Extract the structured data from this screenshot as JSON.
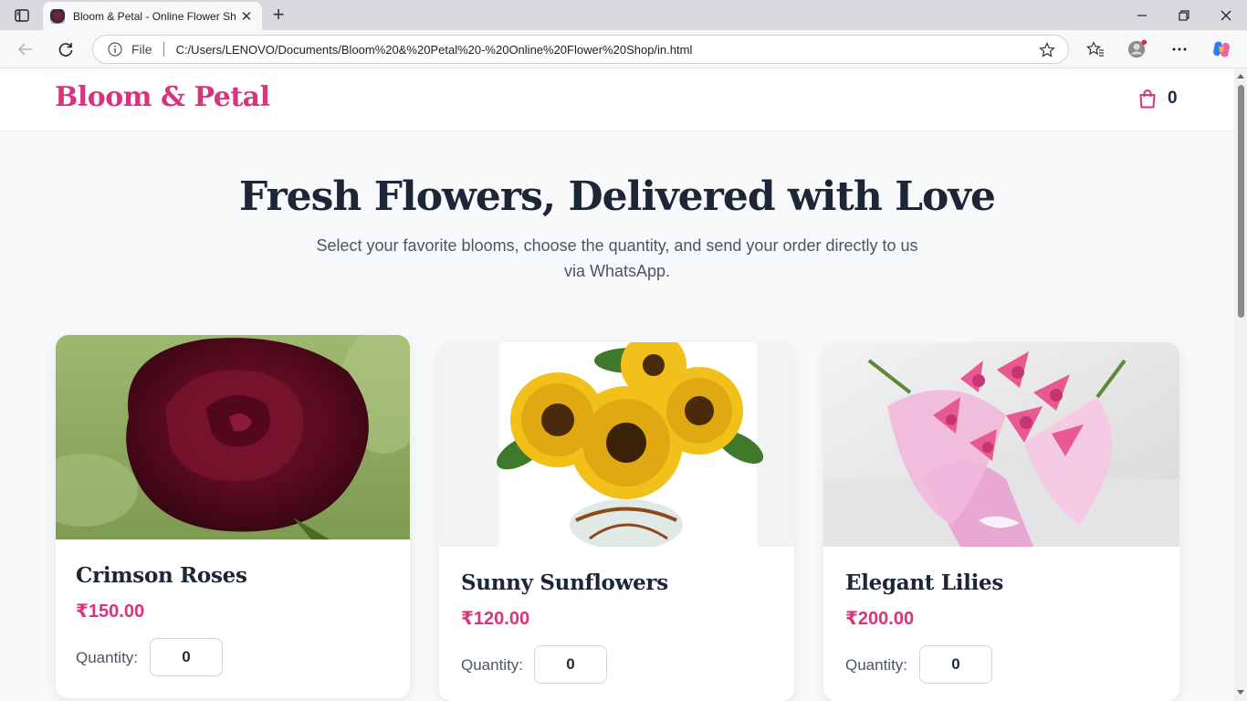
{
  "browser": {
    "tab_title": "Bloom & Petal - Online Flower Sh",
    "address_scheme": "File",
    "address_url": "C:/Users/LENOVO/Documents/Bloom%20&%20Petal%20-%20Online%20Flower%20Shop/in.html",
    "new_tab_symbol": "+",
    "tab_close_symbol": "✕"
  },
  "header": {
    "brand": "Bloom & Petal",
    "cart_count": "0"
  },
  "hero": {
    "title": "Fresh Flowers, Delivered with Love",
    "subtitle": "Select your favorite blooms, choose the quantity, and send your order directly to us via WhatsApp."
  },
  "products": [
    {
      "name": "Crimson Roses",
      "price": "₹150.00",
      "qty_label": "Quantity:",
      "qty": "0"
    },
    {
      "name": "Sunny Sunflowers",
      "price": "₹120.00",
      "qty_label": "Quantity:",
      "qty": "0"
    },
    {
      "name": "Elegant Lilies",
      "price": "₹200.00",
      "qty_label": "Quantity:",
      "qty": "0"
    }
  ],
  "colors": {
    "brand_pink": "#d6357e",
    "heading_dark": "#1c2637"
  }
}
